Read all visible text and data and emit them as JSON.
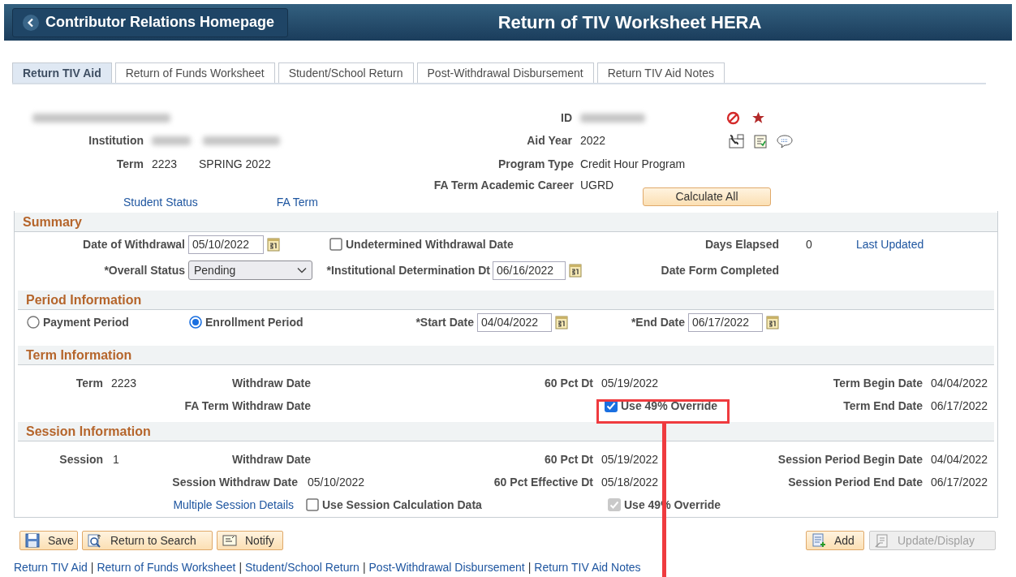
{
  "header": {
    "back_label": "Contributor Relations Homepage",
    "title": "Return of TIV Worksheet HERA"
  },
  "tabs": [
    {
      "label": "Return TIV Aid",
      "selected": true
    },
    {
      "label": "Return of Funds Worksheet",
      "selected": false
    },
    {
      "label": "Student/School Return",
      "selected": false
    },
    {
      "label": "Post-Withdrawal Disbursement",
      "selected": false
    },
    {
      "label": "Return TIV Aid Notes",
      "selected": false
    }
  ],
  "student": {
    "id_label": "ID",
    "institution_label": "Institution",
    "aid_year_label": "Aid Year",
    "aid_year": "2022",
    "term_label": "Term",
    "term": "2223",
    "term_description": "SPRING 2022",
    "program_type_label": "Program Type",
    "program_type": "Credit Hour Program",
    "career_label": "FA Term Academic Career",
    "career": "UGRD",
    "links": [
      "Student Status",
      "FA Term"
    ],
    "calculate_button": "Calculate All"
  },
  "summary": {
    "title": "Summary",
    "withdrawal_label": "Date of Withdrawal",
    "withdrawal_date": "05/10/2022",
    "undetermined": {
      "label": "Undetermined Withdrawal Date",
      "checked": false,
      "disabled": false
    },
    "days_elapsed_label": "Days Elapsed",
    "days_elapsed": "0",
    "last_updated_link": "Last Updated",
    "status_label": "*Overall Status",
    "status": "Pending",
    "determination_label": "*Institutional Determination Dt",
    "determination_date": "06/16/2022",
    "form_completed_label": "Date Form Completed"
  },
  "period": {
    "title": "Period Information",
    "options": [
      {
        "label": "Payment Period",
        "selected": false
      },
      {
        "label": "Enrollment Period",
        "selected": true
      }
    ],
    "start_label": "*Start Date",
    "start_date": "04/04/2022",
    "end_label": "*End Date",
    "end_date": "06/17/2022"
  },
  "term_info": {
    "title": "Term Information",
    "term_label": "Term",
    "term": "2223",
    "withdraw_label": "Withdraw Date",
    "fa_withdraw_label": "FA Term Withdraw Date",
    "pct60_label": "60 Pct Dt",
    "pct60": "05/19/2022",
    "override": {
      "label": "Use 49% Override",
      "checked": true,
      "disabled": false
    },
    "begin_label": "Term Begin Date",
    "begin": "04/04/2022",
    "end_label": "Term End Date",
    "end": "06/17/2022"
  },
  "session_info": {
    "title": "Session Information",
    "session_label": "Session",
    "session": "1",
    "withdraw_label": "Withdraw Date",
    "session_withdraw_label": "Session Withdraw Date",
    "session_withdraw": "05/10/2022",
    "details_link": "Multiple Session Details",
    "calc_data": {
      "label": "Use Session Calculation Data",
      "checked": false,
      "disabled": false
    },
    "pct60_label": "60 Pct Dt",
    "pct60": "05/19/2022",
    "pct60_eff_label": "60 Pct Effective Dt",
    "pct60_eff": "05/18/2022",
    "override": {
      "label": "Use 49% Override",
      "checked": true,
      "disabled": true
    },
    "begin_label": "Session Period Begin Date",
    "begin": "04/04/2022",
    "end_label": "Session Period End Date",
    "end": "06/17/2022"
  },
  "toolbar_left": [
    {
      "label": "Save",
      "disabled": false
    },
    {
      "label": "Return to Search",
      "disabled": false
    },
    {
      "label": "Notify",
      "disabled": false
    }
  ],
  "toolbar_right": [
    {
      "label": "Add",
      "disabled": false
    },
    {
      "label": "Update/Display",
      "disabled": true
    }
  ],
  "footer_separator": "|",
  "footer_links": [
    "Return TIV Aid",
    "Return of Funds Worksheet",
    "Student/School Return",
    "Post-Withdrawal Disbursement",
    "Return TIV Aid Notes"
  ]
}
